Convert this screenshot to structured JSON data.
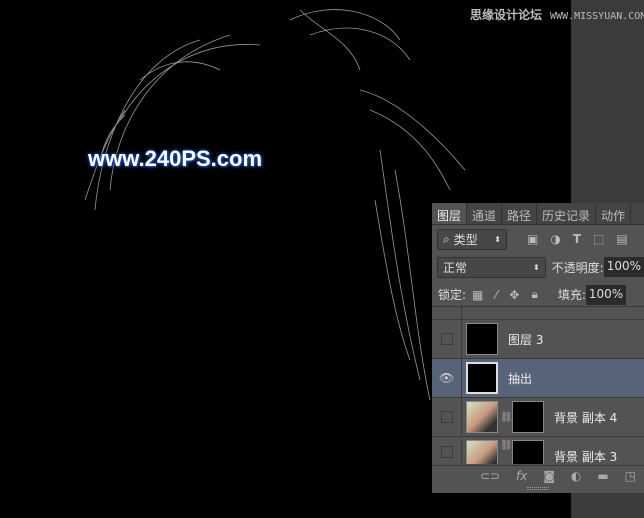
{
  "watermark": {
    "cn": "思缘设计论坛",
    "url": "WWW.MISSYUAN.COM"
  },
  "logo": "www.240PS.com",
  "panel": {
    "tabs": [
      "图层",
      "通道",
      "路径",
      "历史记录",
      "动作"
    ],
    "filter": {
      "label": "类型",
      "icons": [
        "image-filter-icon",
        "adjustment-filter-icon",
        "type-filter-icon",
        "shape-filter-icon",
        "smart-object-filter-icon"
      ]
    },
    "blend_mode": "正常",
    "opacity_label": "不透明度:",
    "opacity": "100%",
    "lock_label": "锁定:",
    "fill_label": "填充:",
    "fill": "100%",
    "layers": [
      {
        "name": "图层 3",
        "visible": false,
        "selected": false
      },
      {
        "name": "抽出",
        "visible": true,
        "selected": true
      },
      {
        "name": "背景 副本 4",
        "visible": false,
        "selected": false
      },
      {
        "name": "背景 副本 3",
        "visible": false,
        "selected": false
      }
    ]
  },
  "colors": {
    "selected": "#576379",
    "panel": "#535353"
  }
}
